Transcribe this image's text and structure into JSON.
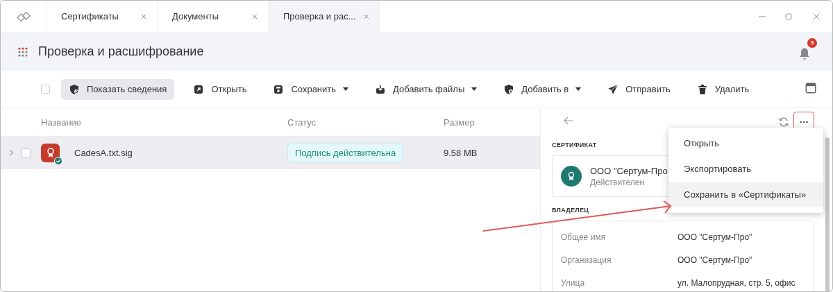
{
  "tabs": [
    {
      "label": "Сертификаты",
      "selected": false
    },
    {
      "label": "Документы",
      "selected": false
    },
    {
      "label": "Проверка и рас...",
      "selected": true
    }
  ],
  "header": {
    "title": "Проверка и расшифрование",
    "notifications": "3"
  },
  "toolbar": {
    "select_all_checked": false,
    "buttons": [
      {
        "label": "Показать сведения",
        "dropdown": false,
        "selected": true
      },
      {
        "label": "Открыть",
        "dropdown": false,
        "selected": false
      },
      {
        "label": "Сохранить",
        "dropdown": true,
        "selected": false
      },
      {
        "label": "Добавить файлы",
        "dropdown": true,
        "selected": false
      },
      {
        "label": "Добавить в",
        "dropdown": true,
        "selected": false
      },
      {
        "label": "Отправить",
        "dropdown": false,
        "selected": false
      },
      {
        "label": "Удалить",
        "dropdown": false,
        "selected": false
      }
    ]
  },
  "table": {
    "columns": [
      "Название",
      "Статус",
      "Размер"
    ],
    "rows": [
      {
        "name": "CadesA.txt.sig",
        "status": "Подпись действительна",
        "size": "9.58 MB",
        "selected": true,
        "checked": false,
        "expanded": false
      }
    ]
  },
  "panel": {
    "more_highlighted": true,
    "certificate_section": "СЕРТИФИКАТ",
    "certificate": {
      "name": "ООО \"Сертум-Про",
      "status": "Действителен"
    },
    "owner_section": "ВЛАДЕЛЕЦ",
    "fields": [
      {
        "label": "Общее имя",
        "value": "ООО \"Сертум-Про\""
      },
      {
        "label": "Организация",
        "value": "ООО \"Сертум-Про\""
      },
      {
        "label": "Улица",
        "value": "ул. Малопрудная, стр. 5, офис"
      }
    ]
  },
  "menu": {
    "items": [
      {
        "label": "Открыть",
        "selected": false
      },
      {
        "label": "Экспортировать",
        "selected": false
      },
      {
        "label": "Сохранить в «Сертификаты»",
        "selected": true
      }
    ]
  }
}
